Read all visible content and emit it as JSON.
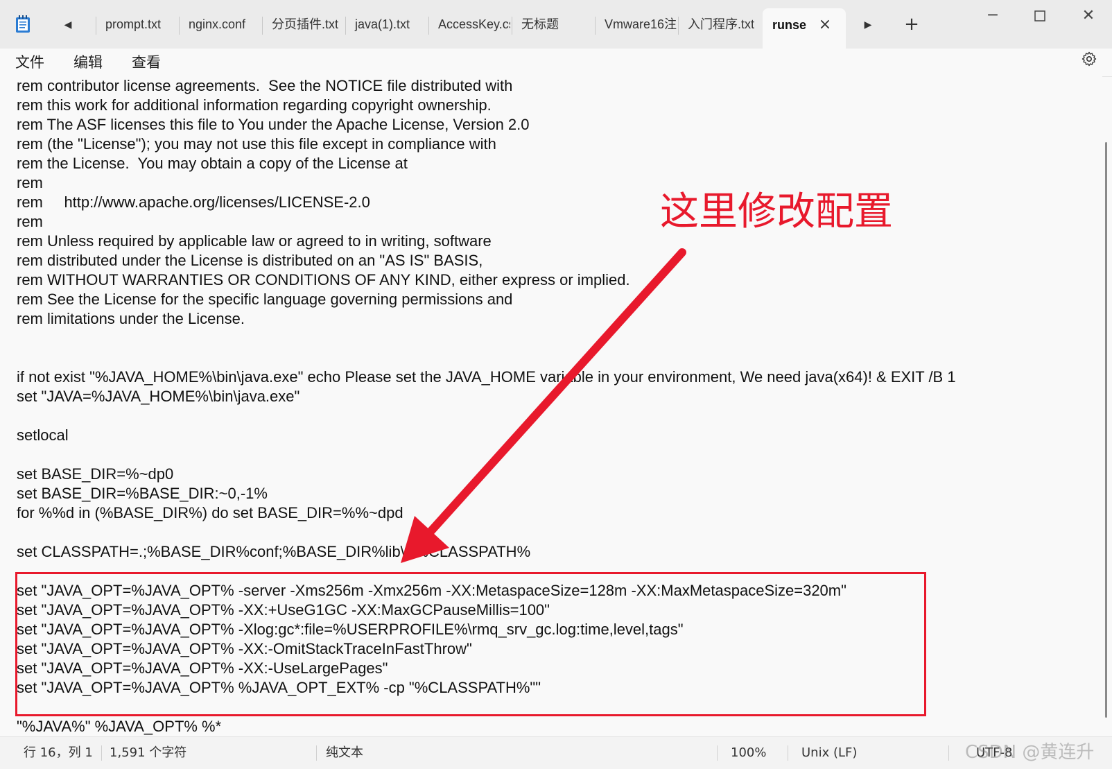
{
  "tabs": [
    {
      "label": "prompt.txt"
    },
    {
      "label": "nginx.conf"
    },
    {
      "label": "分页插件.txt"
    },
    {
      "label": "java(1).txt"
    },
    {
      "label": "AccessKey.cs"
    },
    {
      "label": "无标题"
    },
    {
      "label": "Vmware16注"
    },
    {
      "label": "入门程序.txt"
    },
    {
      "label": "runse"
    }
  ],
  "menu": {
    "file": "文件",
    "edit": "编辑",
    "view": "查看"
  },
  "editor": {
    "lines": [
      "rem contributor license agreements.  See the NOTICE file distributed with",
      "rem this work for additional information regarding copyright ownership.",
      "rem The ASF licenses this file to You under the Apache License, Version 2.0",
      "rem (the \"License\"); you may not use this file except in compliance with",
      "rem the License.  You may obtain a copy of the License at",
      "rem",
      "rem     http://www.apache.org/licenses/LICENSE-2.0",
      "rem",
      "rem Unless required by applicable law or agreed to in writing, software",
      "rem distributed under the License is distributed on an \"AS IS\" BASIS,",
      "rem WITHOUT WARRANTIES OR CONDITIONS OF ANY KIND, either express or implied.",
      "rem See the License for the specific language governing permissions and",
      "rem limitations under the License.",
      "",
      "",
      "if not exist \"%JAVA_HOME%\\bin\\java.exe\" echo Please set the JAVA_HOME variable in your environment, We need java(x64)! & EXIT /B 1",
      "set \"JAVA=%JAVA_HOME%\\bin\\java.exe\"",
      "",
      "setlocal",
      "",
      "set BASE_DIR=%~dp0",
      "set BASE_DIR=%BASE_DIR:~0,-1%",
      "for %%d in (%BASE_DIR%) do set BASE_DIR=%%~dpd",
      "",
      "set CLASSPATH=.;%BASE_DIR%conf;%BASE_DIR%lib\\*;%CLASSPATH%",
      "",
      "set \"JAVA_OPT=%JAVA_OPT% -server -Xms256m -Xmx256m -XX:MetaspaceSize=128m -XX:MaxMetaspaceSize=320m\"",
      "set \"JAVA_OPT=%JAVA_OPT% -XX:+UseG1GC -XX:MaxGCPauseMillis=100\"",
      "set \"JAVA_OPT=%JAVA_OPT% -Xlog:gc*:file=%USERPROFILE%\\rmq_srv_gc.log:time,level,tags\"",
      "set \"JAVA_OPT=%JAVA_OPT% -XX:-OmitStackTraceInFastThrow\"",
      "set \"JAVA_OPT=%JAVA_OPT% -XX:-UseLargePages\"",
      "set \"JAVA_OPT=%JAVA_OPT% %JAVA_OPT_EXT% -cp \"%CLASSPATH%\"\"",
      "",
      "\"%JAVA%\" %JAVA_OPT% %*"
    ]
  },
  "annotation": {
    "label": "这里修改配置",
    "color": "#e8192c"
  },
  "status": {
    "position": "行 16，列 1",
    "char_count": "1,591 个字符",
    "file_type": "纯文本",
    "zoom": "100%",
    "line_ending": "Unix (LF)",
    "encoding": "UTF-8"
  },
  "watermark": "CSDN @黄连升"
}
